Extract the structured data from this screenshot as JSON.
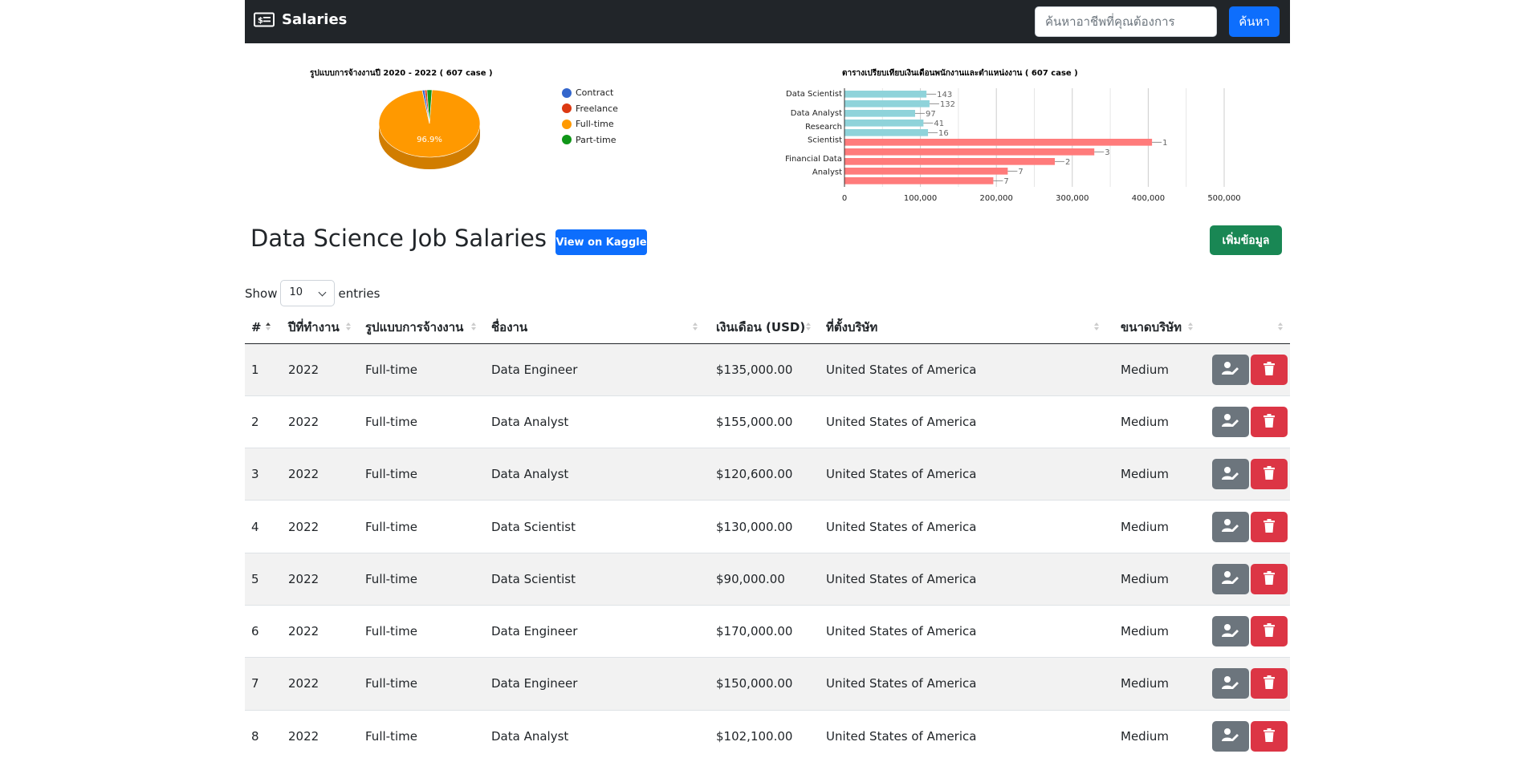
{
  "navbar": {
    "brand": "Salaries",
    "brand_icon": "money-bill-icon",
    "search_placeholder": "ค้นหาอาชีพที่คุณต้องการ",
    "search_button": "ค้นหา"
  },
  "charts": {
    "pie_title": "รูปแบบการจ้างงานปี 2020 - 2022 ( 607 case )",
    "bar_title": "ตารางเปรียบเทียบเงินเดือนพนักงานและตำแหน่งงาน ( 607 case )"
  },
  "chart_data": [
    {
      "type": "pie",
      "title": "รูปแบบการจ้างงานปี 2020 - 2022 ( 607 case )",
      "categories": [
        "Contract",
        "Freelance",
        "Full-time",
        "Part-time"
      ],
      "values": [
        0.8,
        0.7,
        96.9,
        1.6
      ],
      "colors": [
        "#3366cc",
        "#dc3912",
        "#ff9900",
        "#109618"
      ],
      "slice_label": "96.9%",
      "legend_position": "right",
      "style": "3d"
    },
    {
      "type": "bar",
      "orientation": "horizontal",
      "title": "ตารางเปรียบเทียบเงินเดือนพนักงานและตำแหน่งงาน ( 607 case )",
      "y_tick_labels": [
        "Data Scientist",
        "Data Analyst",
        "Research Scientist",
        "Financial Data Analyst"
      ],
      "x_ticks": [
        "0",
        "100,000",
        "200,000",
        "300,000",
        "400,000",
        "500,000"
      ],
      "xlim": [
        0,
        500000
      ],
      "grid": true,
      "bars": [
        {
          "value": 108000,
          "label": "143",
          "color": "#8fd3da"
        },
        {
          "value": 112000,
          "label": "132",
          "color": "#8fd3da"
        },
        {
          "value": 93000,
          "label": "97",
          "color": "#8fd3da"
        },
        {
          "value": 104000,
          "label": "41",
          "color": "#8fd3da"
        },
        {
          "value": 110000,
          "label": "16",
          "color": "#8fd3da"
        },
        {
          "value": 405000,
          "label": "1",
          "color": "#ff7b7b"
        },
        {
          "value": 329000,
          "label": "3",
          "color": "#ff7b7b"
        },
        {
          "value": 277000,
          "label": "2",
          "color": "#ff7b7b"
        },
        {
          "value": 215000,
          "label": "7",
          "color": "#ff7b7b"
        },
        {
          "value": 196000,
          "label": "7",
          "color": "#ff7b7b"
        }
      ]
    }
  ],
  "header": {
    "title": "Data Science Job Salaries",
    "kaggle_button": "View on Kaggle",
    "add_button": "เพิ่มข้อมูล"
  },
  "length_menu": {
    "show": "Show",
    "value": "10",
    "entries": "entries"
  },
  "table": {
    "columns": [
      "#",
      "ปีที่ทำงาน",
      "รูปแบบการจ้างงาน",
      "ชื่องาน",
      "เงินเดือน (USD)",
      "ที่ตั้งบริษัท",
      "ขนาดบริษัท",
      ""
    ],
    "rows": [
      [
        "1",
        "2022",
        "Full-time",
        "Data Engineer",
        "$135,000.00",
        "United States of America",
        "Medium"
      ],
      [
        "2",
        "2022",
        "Full-time",
        "Data Analyst",
        "$155,000.00",
        "United States of America",
        "Medium"
      ],
      [
        "3",
        "2022",
        "Full-time",
        "Data Analyst",
        "$120,600.00",
        "United States of America",
        "Medium"
      ],
      [
        "4",
        "2022",
        "Full-time",
        "Data Scientist",
        "$130,000.00",
        "United States of America",
        "Medium"
      ],
      [
        "5",
        "2022",
        "Full-time",
        "Data Scientist",
        "$90,000.00",
        "United States of America",
        "Medium"
      ],
      [
        "6",
        "2022",
        "Full-time",
        "Data Engineer",
        "$170,000.00",
        "United States of America",
        "Medium"
      ],
      [
        "7",
        "2022",
        "Full-time",
        "Data Engineer",
        "$150,000.00",
        "United States of America",
        "Medium"
      ],
      [
        "8",
        "2022",
        "Full-time",
        "Data Analyst",
        "$102,100.00",
        "United States of America",
        "Medium"
      ]
    ],
    "edit_icon": "user-edit-icon",
    "delete_icon": "trash-icon"
  }
}
